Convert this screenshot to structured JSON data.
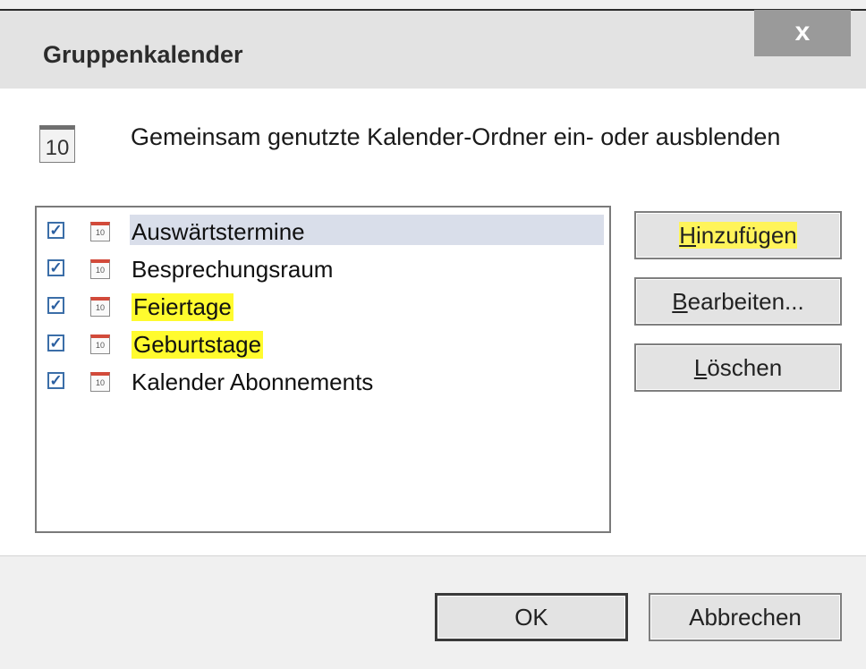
{
  "window": {
    "title": "Gruppenkalender",
    "close_glyph": "x"
  },
  "header": {
    "icon_text": "10",
    "description": "Gemeinsam genutzte Kalender-Ordner ein- oder ausblenden"
  },
  "list": {
    "items": [
      {
        "label": "Auswärtstermine",
        "checked": true,
        "selected": true
      },
      {
        "label": "Besprechungsraum",
        "checked": true
      },
      {
        "label": "Feiertage",
        "checked": true,
        "highlighted": true
      },
      {
        "label": "Geburtstage",
        "checked": true,
        "highlighted": true
      },
      {
        "label": "Kalender Abonnements",
        "checked": true
      }
    ],
    "item_icon_text": "10"
  },
  "side_buttons": {
    "add_first": "H",
    "add_rest": "inzufügen",
    "edit_first": "B",
    "edit_rest": "earbeiten...",
    "delete_first": "L",
    "delete_rest": "öschen"
  },
  "footer": {
    "ok_label": "OK",
    "cancel_label": "Abbrechen"
  },
  "colors": {
    "highlight": "#fffb2e",
    "selection": "#d9deea",
    "checkbox": "#3b6ea8"
  }
}
